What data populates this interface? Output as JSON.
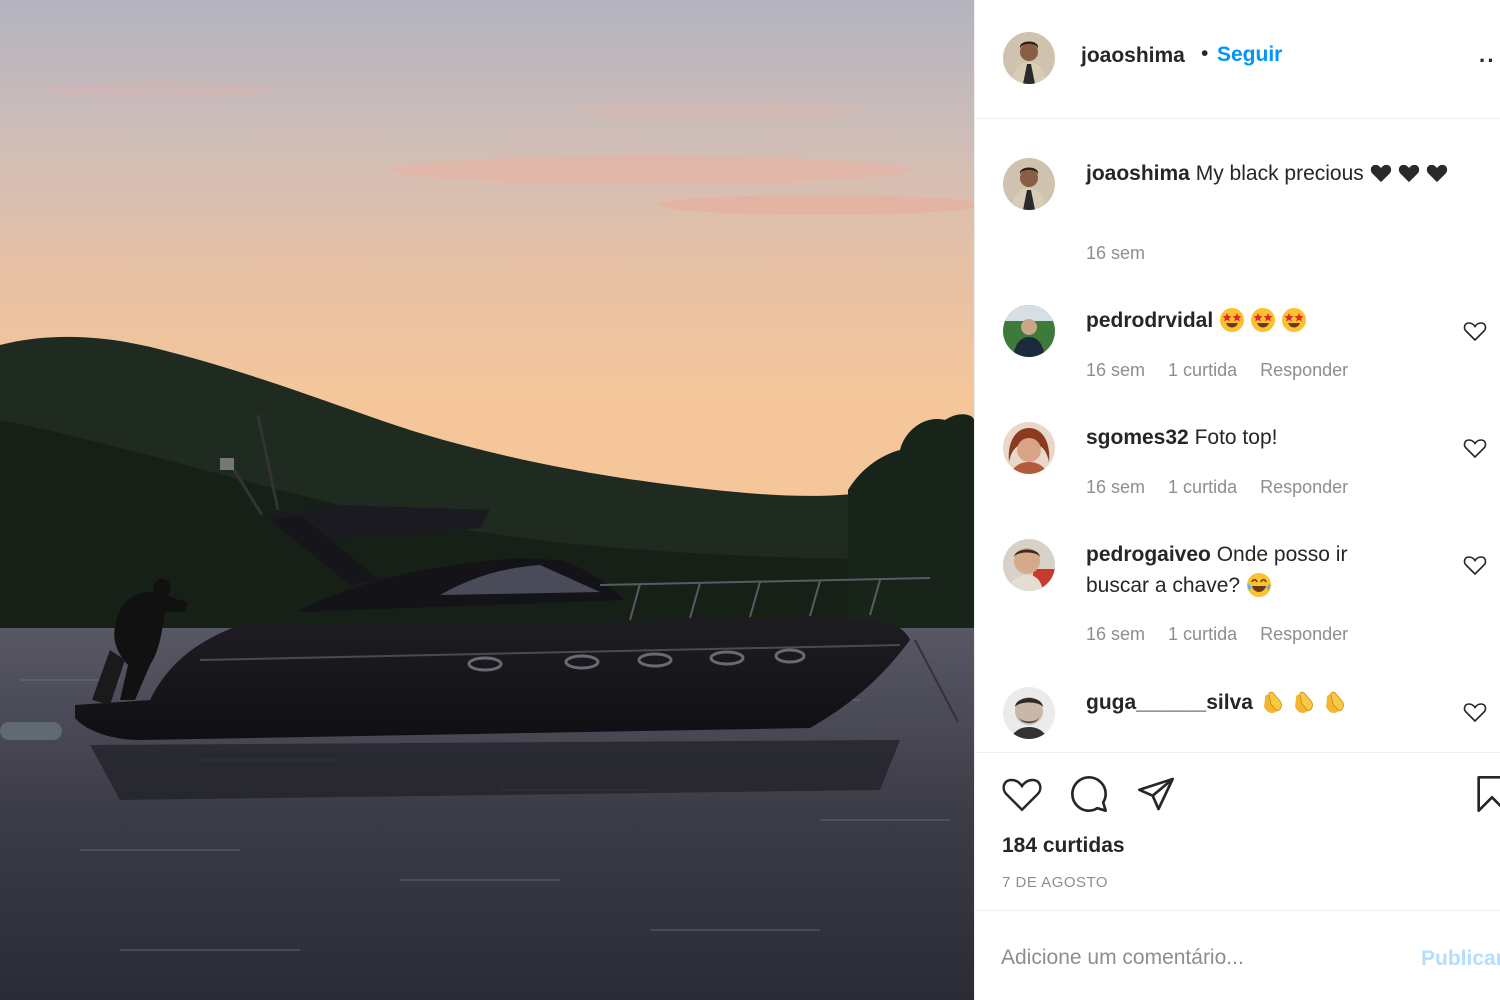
{
  "post": {
    "author": "joaoshima",
    "follow_label": "Seguir",
    "separator": "•",
    "more_label": "··",
    "caption_text": "My black precious",
    "caption_time": "16 sem",
    "photo_subject": "black motor yacht at sunset",
    "likes_label": "184 curtidas",
    "date_label": "7 DE AGOSTO"
  },
  "comments": [
    {
      "user": "pedrodrvidal",
      "text": "",
      "emojis": [
        "star-struck",
        "star-struck",
        "star-struck"
      ],
      "time": "16 sem",
      "likes": "1 curtida",
      "reply": "Responder"
    },
    {
      "user": "sgomes32",
      "text": "Foto top!",
      "emojis": [],
      "time": "16 sem",
      "likes": "1 curtida",
      "reply": "Responder"
    },
    {
      "user": "pedrogaiveo",
      "text": "Onde posso ir buscar a chave?",
      "emojis": [
        "tears-of-joy"
      ],
      "time": "16 sem",
      "likes": "1 curtida",
      "reply": "Responder"
    },
    {
      "user": "guga______silva",
      "text": "",
      "emojis": [
        "clapping-hands",
        "clapping-hands",
        "clapping-hands"
      ]
    }
  ],
  "add_comment": {
    "placeholder": "Adicione um comentário...",
    "publish_label": "Publicar"
  },
  "colors": {
    "link_blue": "#0095f6",
    "muted": "#8e8e8e",
    "text": "#262626",
    "publish_disabled": "#b2dffc"
  }
}
